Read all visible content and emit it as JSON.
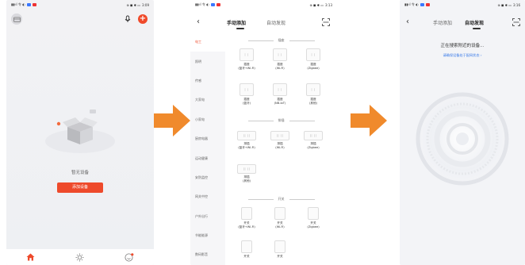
{
  "phone1": {
    "status_left": "4G 5G",
    "status_right": "3:09",
    "empty_text": "暂无设备",
    "add_button": "添加设备"
  },
  "phone2": {
    "status_right": "3:13",
    "tabs": [
      "手动添加",
      "自动发现"
    ],
    "categories": [
      "电工",
      "照明",
      "传感",
      "大家电",
      "小家电",
      "厨房电器",
      "运动健康",
      "安防监控",
      "网关中控",
      "户外出行",
      "节能能源",
      "数码影音"
    ],
    "sections": {
      "socket": "插座",
      "switch_panel": "排插",
      "switch": "开关"
    },
    "socket_devices": [
      "插座\n(蓝牙+Wi-Fi)",
      "插座\n(Wi-Fi)",
      "插座\n(Zigbee)",
      "插座\n(蓝牙)",
      "插座\n(NB-IoT)",
      "插座\n(其他)"
    ],
    "strip_devices": [
      "排插\n(蓝牙+Wi-Fi)",
      "排插\n(Wi-Fi)",
      "排插\n(Zigbee)",
      "排插\n(其他)"
    ],
    "switch_devices": [
      "开关\n(蓝牙+Wi-Fi)",
      "开关\n(Wi-Fi)",
      "开关\n(Zigbee)",
      "开关",
      "开关"
    ]
  },
  "phone3": {
    "status_right": "3:16",
    "tabs": [
      "手动添加",
      "自动发现"
    ],
    "searching": "正在搜索附近的设备...",
    "hint": "请确保设备处于配网状态 ›"
  },
  "colors": {
    "accent": "#ee4a2b",
    "arrow": "#f08a2c",
    "link": "#3a7be8"
  }
}
